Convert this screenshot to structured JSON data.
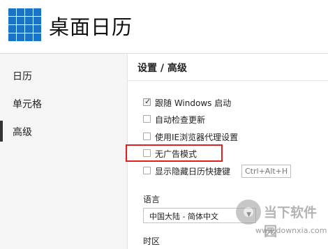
{
  "app": {
    "title": "桌面日历"
  },
  "sidebar": {
    "items": [
      {
        "label": "日历",
        "active": false
      },
      {
        "label": "单元格",
        "active": false
      },
      {
        "label": "高级",
        "active": true
      }
    ]
  },
  "content": {
    "title": "设置 / 高级",
    "options": [
      {
        "label": "跟随 Windows 启动",
        "checked": true
      },
      {
        "label": "自动检查更新",
        "checked": false
      },
      {
        "label": "使用IE浏览器代理设置",
        "checked": false
      },
      {
        "label": "无广告模式",
        "checked": false,
        "highlighted": true
      },
      {
        "label": "显示隐藏日历快捷键",
        "checked": false
      }
    ],
    "hotkey_value": "Ctrl+Alt+H",
    "language_label": "语言",
    "language_value": "中国大陆 - 简体中文",
    "timezone_label": "时区"
  },
  "watermark": {
    "text": "当下软件园",
    "url": "www.downxia.com"
  },
  "colors": {
    "logo": "#1a73c7",
    "highlight": "#e02020",
    "active_bar": "#333333",
    "sidebar_bg": "#f5f5f5"
  }
}
